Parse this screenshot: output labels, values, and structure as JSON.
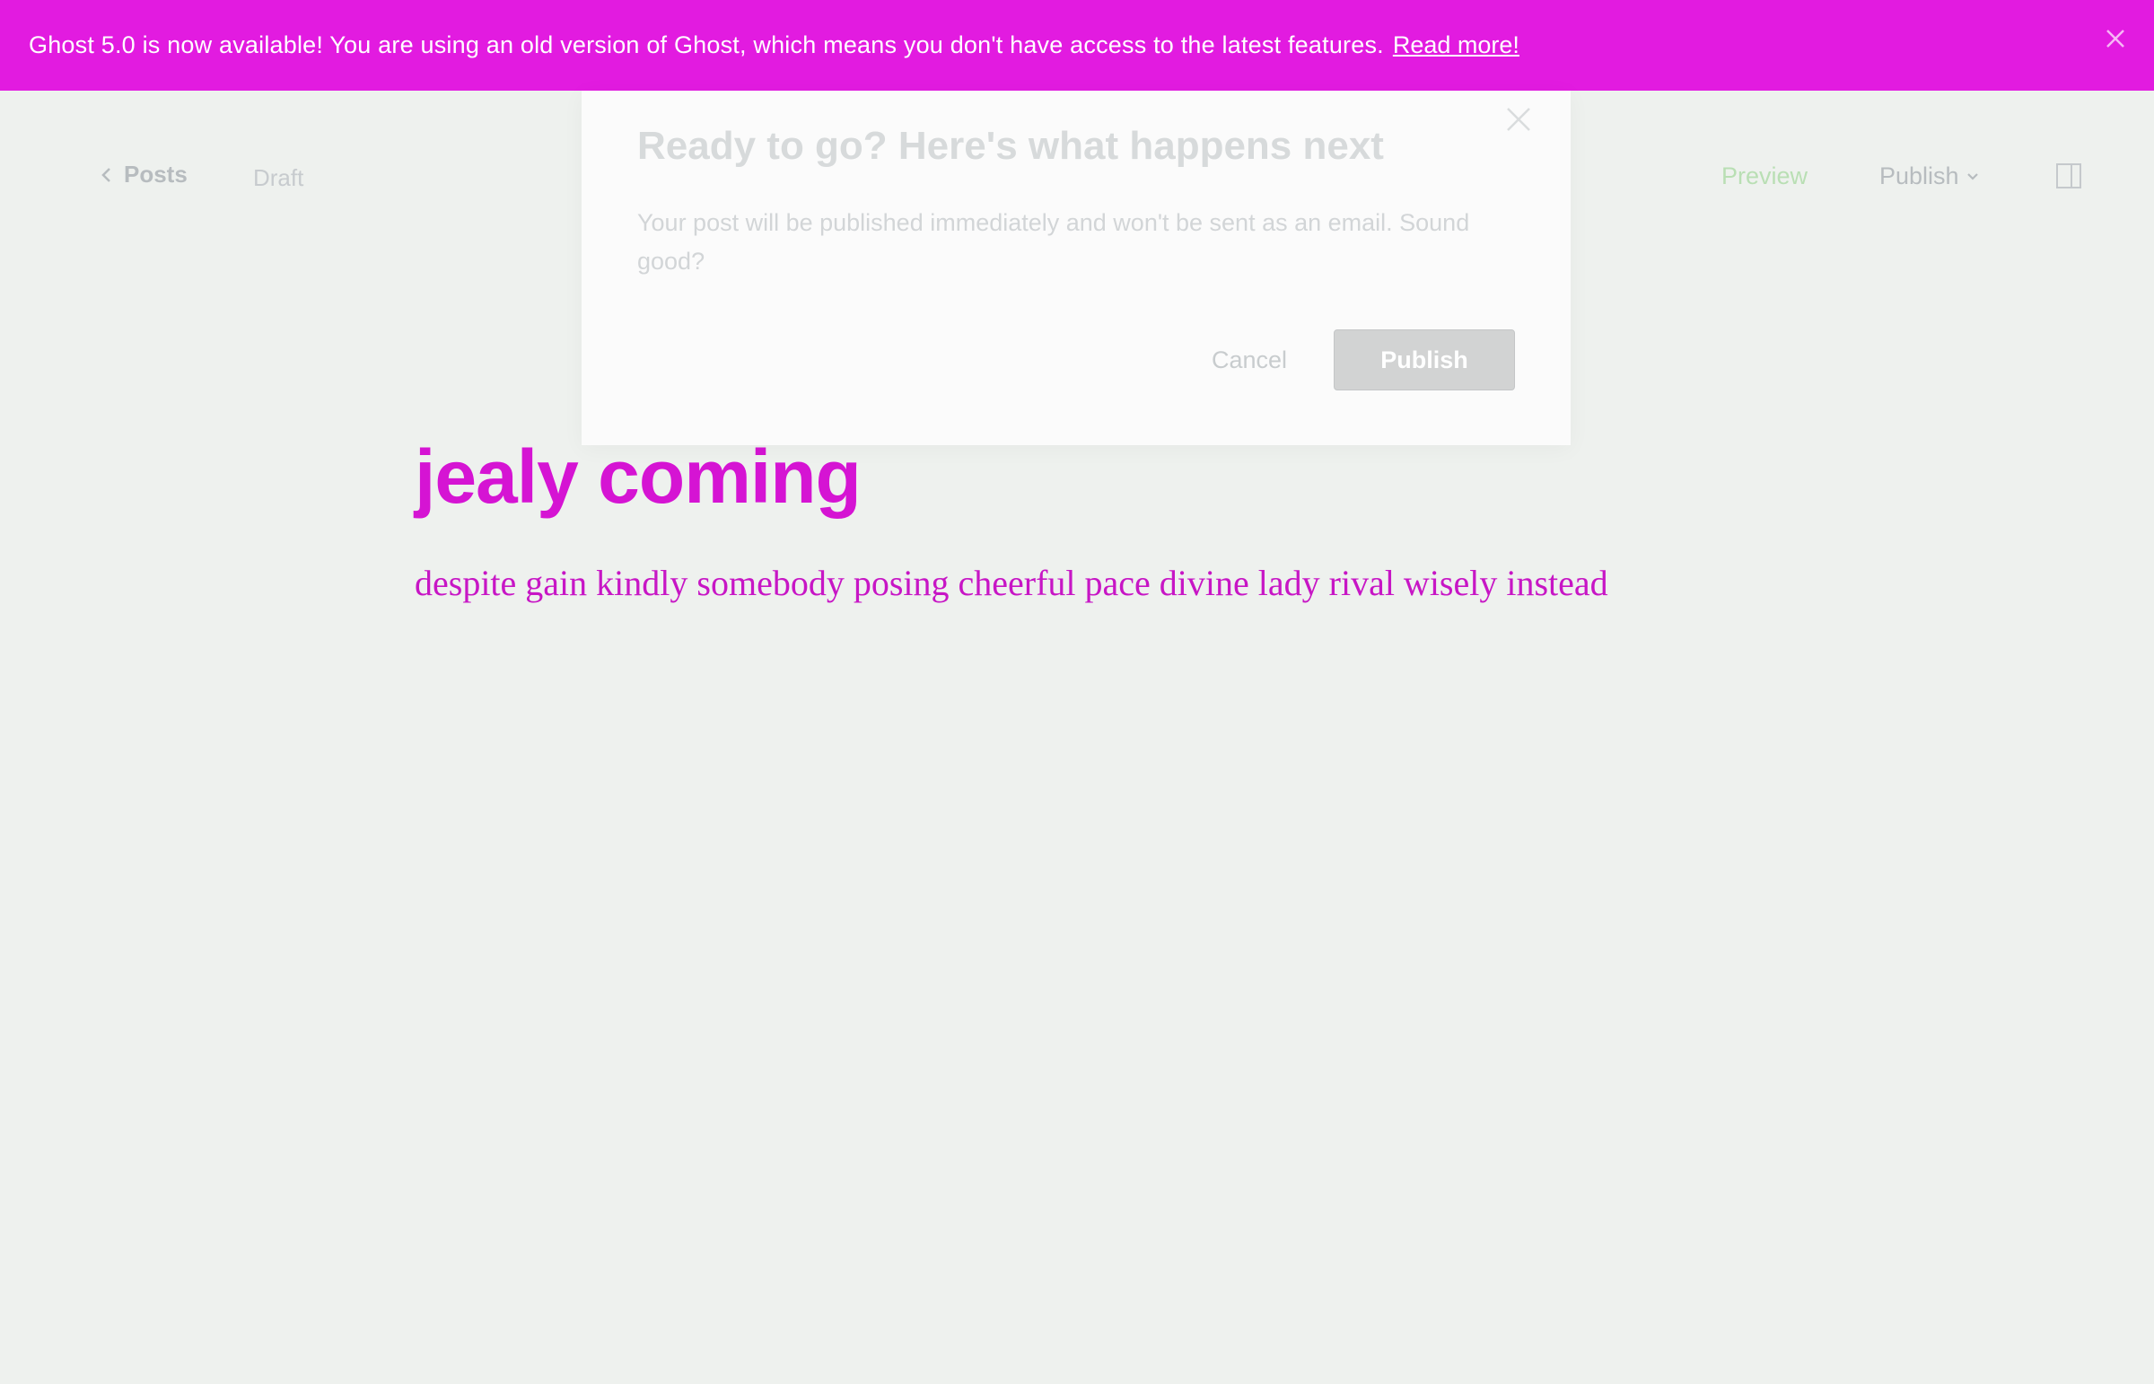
{
  "banner": {
    "message": "Ghost 5.0 is now available! You are using an old version of Ghost, which means you don't have access to the latest features.",
    "link_label": "Read more!",
    "background_color": "#e21be0"
  },
  "header": {
    "back_label": "Posts",
    "status": "Draft",
    "preview_label": "Preview",
    "publish_label": "Publish"
  },
  "post": {
    "title": "jealy coming",
    "body": "despite gain kindly somebody posing cheerful pace divine lady rival wisely instead"
  },
  "modal": {
    "title": "Ready to go? Here's what happens next",
    "body": "Your post will be published immediately and won't be sent as an email. Sound good?",
    "cancel_label": "Cancel",
    "publish_label": "Publish"
  }
}
